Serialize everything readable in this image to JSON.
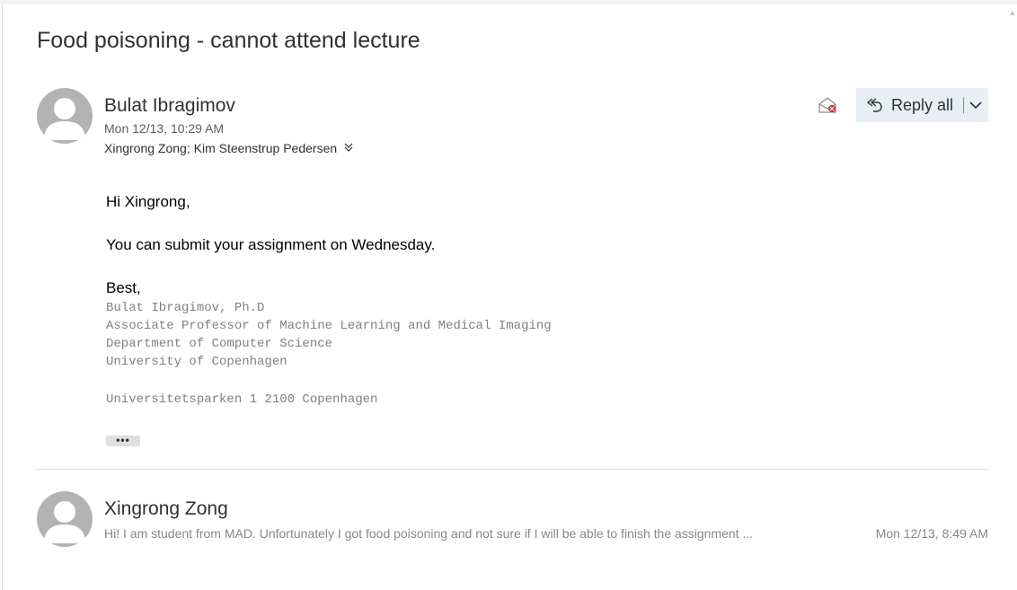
{
  "subject": "Food poisoning - cannot attend lecture",
  "message": {
    "sender": "Bulat Ibragimov",
    "date": "Mon 12/13, 10:29 AM",
    "recipients": "Xingrong Zong; Kim Steenstrup Pedersen",
    "reply_all_label": "Reply all",
    "body": {
      "greeting": "Hi Xingrong,",
      "line1": "You can submit your assignment on Wednesday.",
      "closing": "Best,"
    },
    "signature": {
      "name": "Bulat Ibragimov, Ph.D",
      "title": "Associate Professor of Machine Learning and Medical Imaging",
      "department": "Department of Computer Science",
      "university": "University of Copenhagen",
      "address": "Universitetsparken 1 2100 Copenhagen"
    },
    "more_label": "•••"
  },
  "previous_message": {
    "sender": "Xingrong Zong",
    "preview": "Hi! I am student from MAD. Unfortunately I got food poisoning and not sure if I will be able to finish the assignment ...",
    "date": "Mon 12/13, 8:49 AM"
  },
  "icons": {
    "read_receipt": "envelope-open-icon",
    "reply_all": "reply-all-icon",
    "expand": "chevron-down-icon",
    "recipients_expand": "double-chevron-down-icon"
  },
  "colors": {
    "reply_button_bg": "#e8eef6",
    "avatar": "#b3b3b3",
    "receipt_accent": "#d13438"
  }
}
